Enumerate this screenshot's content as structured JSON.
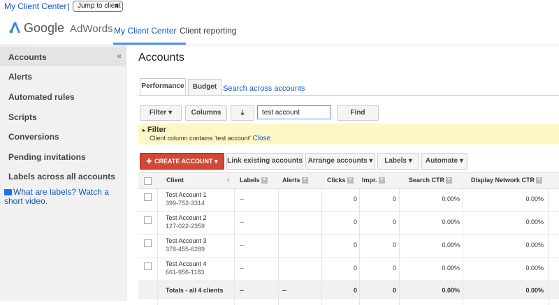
{
  "topbar": {
    "mcc_link": "My Client Center",
    "separator": "|",
    "jump_label": "Jump to client",
    "jump_arrow": "⬍"
  },
  "header": {
    "logo_google": "Google",
    "logo_adwords": "AdWords",
    "nav": [
      "My Client Center",
      "Client reporting"
    ]
  },
  "sidebar": {
    "items": [
      {
        "label": "Accounts"
      },
      {
        "label": "Alerts"
      },
      {
        "label": "Automated rules"
      },
      {
        "label": "Scripts"
      },
      {
        "label": "Conversions"
      },
      {
        "label": "Pending invitations"
      },
      {
        "label": "Labels across all accounts"
      }
    ],
    "collapse_glyph": "«",
    "help_text": "What are labels? Watch a short video."
  },
  "main": {
    "title": "Accounts",
    "tabs": [
      "Performance",
      "Budget"
    ],
    "tab_link": "Search across accounts",
    "toolbar": {
      "filter": "Filter ▾",
      "columns": "Columns",
      "download_icon": "⤓",
      "search_value": "test account",
      "find": "Find"
    },
    "filter": {
      "title": "Filter",
      "toggle": "▸",
      "description": "Client column contains 'test account'",
      "close": "Close"
    },
    "actions": {
      "create": "CREATE ACCOUNT ▾",
      "create_plus": "✚",
      "link": "Link existing accounts",
      "arrange": "Arrange accounts ▾",
      "labels": "Labels ▾",
      "automate": "Automate ▾"
    }
  },
  "table": {
    "columns": [
      "Client",
      "Labels",
      "Alerts",
      "Clicks",
      "Impr.",
      "Search CTR",
      "Display Network CTR"
    ],
    "sort_glyph": "↑",
    "help_glyph": "?",
    "rows": [
      {
        "name": "Test Account 1",
        "id": "399-752-3314",
        "labels": "--",
        "alerts": "",
        "clicks": "0",
        "impr": "0",
        "search_ctr": "0.00%",
        "display_ctr": "0.00%"
      },
      {
        "name": "Test Account 2",
        "id": "127-022-2359",
        "labels": "--",
        "alerts": "",
        "clicks": "0",
        "impr": "0",
        "search_ctr": "0.00%",
        "display_ctr": "0.00%"
      },
      {
        "name": "Test Account 3",
        "id": "378-455-6289",
        "labels": "--",
        "alerts": "",
        "clicks": "0",
        "impr": "0",
        "search_ctr": "0.00%",
        "display_ctr": "0.00%"
      },
      {
        "name": "Test Account 4",
        "id": "661-956-1183",
        "labels": "--",
        "alerts": "",
        "clicks": "0",
        "impr": "0",
        "search_ctr": "0.00%",
        "display_ctr": "0.00%"
      }
    ],
    "total": {
      "label": "Totals - all 4 clients",
      "labels": "--",
      "alerts": "--",
      "clicks": "0",
      "impr": "0",
      "search_ctr": "0.00%",
      "display_ctr": "0.00%"
    }
  },
  "colors": {
    "link": "#1155cc",
    "accent": "#4d90fe",
    "create": "#d14836",
    "filter_bg": "#fdf6c5"
  }
}
